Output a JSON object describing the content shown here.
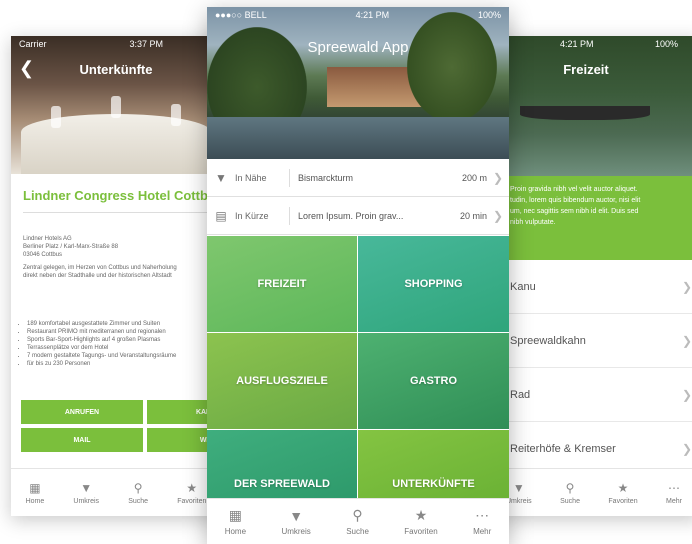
{
  "left": {
    "status": {
      "carrier": "Carrier",
      "time": "3:37 PM"
    },
    "title": "Unterkünfte",
    "hotel_name": "Lindner Congress Hotel Cottbus",
    "address_lines": [
      "Lindner Hotels AG",
      "Berliner Platz / Karl-Marx-Straße 88",
      "03046 Cottbus"
    ],
    "description_lines": [
      "Zentral gelegen, im Herzen von Cottbus und Naherholung",
      "direkt neben der Stadthalle und der historischen Altstadt"
    ],
    "bullets": [
      "189 komfortabel ausgestattete Zimmer und Suiten",
      "Restaurant PRIMO mit mediterranen und regionalen",
      "Sports Bar-Sport-Highlights auf 4 großen Plasmas",
      "Terrassenplätze vor dem Hotel",
      "7 modern gestaltete Tagungs- und Veranstaltungsräume",
      "für bis zu 230 Personen"
    ],
    "buttons": {
      "call": "ANRUFEN",
      "map": "KARTE",
      "mail": "MAIL",
      "web": "WEB"
    },
    "tabs": [
      "Home",
      "Umkreis",
      "Suche",
      "Favoriten"
    ]
  },
  "center": {
    "status": {
      "carrier": "●●●○○ BELL",
      "time": "4:21 PM",
      "battery": "100%"
    },
    "title": "Spreewald App",
    "near": {
      "label": "In Nähe",
      "value": "Bismarckturm",
      "distance": "200 m"
    },
    "soon": {
      "label": "In Kürze",
      "value": "Lorem Ipsum. Proin grav...",
      "time": "20 min"
    },
    "tiles": [
      "FREIZEIT",
      "SHOPPING",
      "AUSFLUGSZIELE",
      "GASTRO",
      "DER SPREEWALD",
      "UNTERKÜNFTE"
    ],
    "tabs": [
      "Home",
      "Umkreis",
      "Suche",
      "Favoriten",
      "Mehr"
    ]
  },
  "right": {
    "status": {
      "time": "4:21 PM",
      "battery": "100%"
    },
    "title": "Freizeit",
    "text_lines": [
      "Proin gravida nibh vel velit auctor aliquet.",
      "tudin, lorem quis bibendum auctor, nisi elit",
      "um, nec sagittis sem nibh id elit. Duis sed",
      "nibh vulputate."
    ],
    "items": [
      "Kanu",
      "Spreewaldkahn",
      "Rad",
      "Reiterhöfe & Kremser"
    ],
    "tabs": [
      "Umkreis",
      "Suche",
      "Favoriten",
      "Mehr"
    ]
  },
  "colors": {
    "accent_green": "#7bbf3c",
    "tile_green_light": "#6fc26a",
    "tile_green_dark": "#3fae7e"
  }
}
